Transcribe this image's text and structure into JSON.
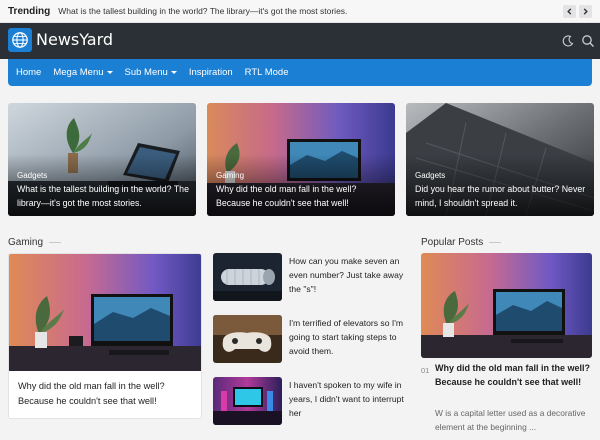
{
  "trending": {
    "label": "Trending",
    "text": "What is the tallest building in the world? The library—it's got the most stories."
  },
  "header": {
    "logo_text": "NewsYard",
    "brand_color": "#1b7fd3",
    "bg_color": "#2b3036"
  },
  "nav": {
    "items": [
      {
        "label": "Home"
      },
      {
        "label": "Mega Menu"
      },
      {
        "label": "Sub Menu"
      },
      {
        "label": "Inspiration"
      },
      {
        "label": "RTL Mode"
      }
    ]
  },
  "hero": [
    {
      "category": "Gadgets",
      "title": "What is the tallest building in the world? The library—it's got the most stories."
    },
    {
      "category": "Gaming",
      "title": "Why did the old man fall in the well? Because he couldn't see that well!"
    },
    {
      "category": "Gadgets",
      "title": "Did you hear the rumor about butter? Never mind, I shouldn't spread it."
    }
  ],
  "gaming": {
    "heading": "Gaming",
    "main_title": "Why did the old man fall in the well? Because he couldn't see that well!",
    "list": [
      {
        "text": "How can you make seven an even number? Just take away the \"s\"!"
      },
      {
        "text": "I'm terrified of elevators so I'm going to start taking steps to avoid them."
      },
      {
        "text": "I haven't spoken to my wife in years, I didn't want to interrupt her"
      }
    ]
  },
  "popular": {
    "heading": "Popular Posts",
    "number": "01",
    "title": "Why did the old man fall in the well? Because he couldn't see that well!",
    "excerpt": "W is a capital letter used as a decorative element at the beginning ..."
  }
}
